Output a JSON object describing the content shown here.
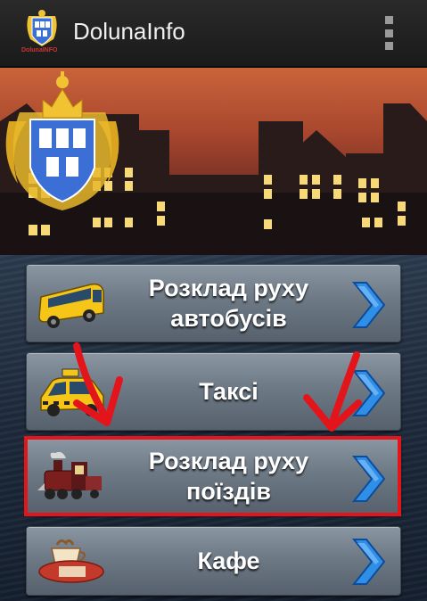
{
  "app": {
    "title": "DolunaInfo",
    "logo_text": "DolunaINFO",
    "icon": "coat-of-arms-icon"
  },
  "actionbar": {
    "menu_icon": "overflow-menu-icon"
  },
  "menu": [
    {
      "label": "Розклад руху автобусів",
      "icon": "bus-icon",
      "chevron": "chevron-right-icon"
    },
    {
      "label": "Таксі",
      "icon": "taxi-icon",
      "chevron": "chevron-right-icon"
    },
    {
      "label": "Розклад руху поїздів",
      "icon": "train-icon",
      "chevron": "chevron-right-icon"
    },
    {
      "label": "Кафе",
      "icon": "cafe-icon",
      "chevron": "chevron-right-icon"
    }
  ],
  "colors": {
    "highlight": "#e4141b",
    "chevron": "#2f8ee6",
    "button_label": "#ffffff"
  }
}
